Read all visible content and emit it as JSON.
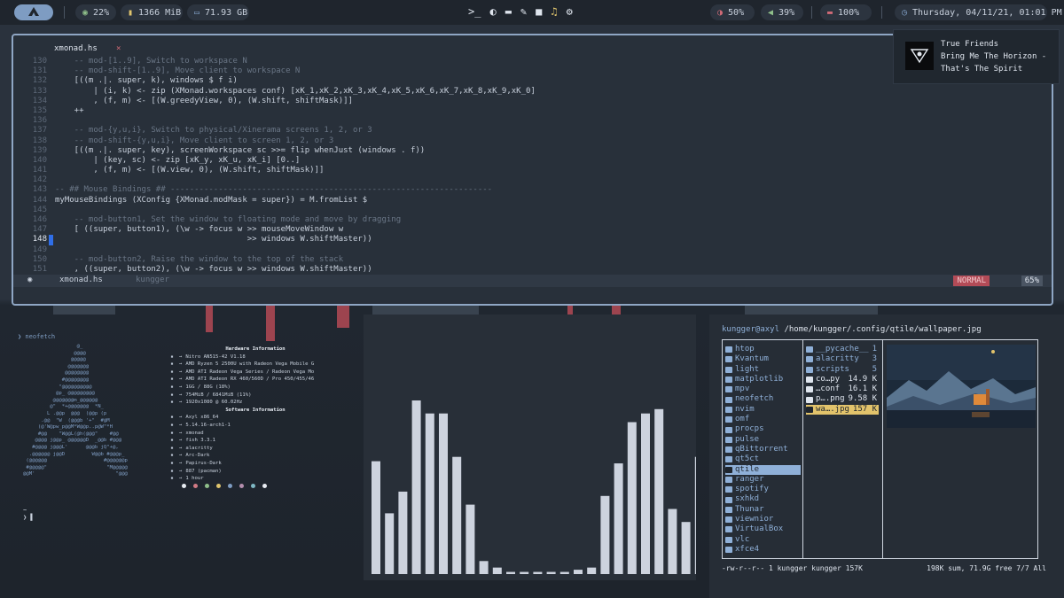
{
  "topbar": {
    "arch_icon": "arch-logo-icon",
    "cpu": "22%",
    "memory": "1366 MiB",
    "disk": "71.93 GB",
    "brightness": "50%",
    "volume": "39%",
    "battery": "100%",
    "datetime": "Thursday, 04/11/21, 01:01 PM",
    "center_icons": [
      "terminal-icon",
      "firefox-icon",
      "folder-icon",
      "edit-icon",
      "video-icon",
      "music-icon",
      "gear-icon"
    ]
  },
  "notification": {
    "title": "True Friends",
    "artist": "Bring Me The Horizon -",
    "album": "That's The Spirit"
  },
  "editor": {
    "tab": "xmonad.hs",
    "tab_close": "×",
    "status_file": "xmonad.hs",
    "status_dir": "kungger",
    "mode": "NORMAL",
    "percent": "65%",
    "lines": [
      {
        "n": "130",
        "t": "    -- mod-[1..9], Switch to workspace N",
        "c": true
      },
      {
        "n": "131",
        "t": "    -- mod-shift-[1..9], Move client to workspace N",
        "c": true
      },
      {
        "n": "132",
        "t": "    [((m .|. super, k), windows $ f i)",
        "c": false
      },
      {
        "n": "133",
        "t": "        | (i, k) <- zip (XMonad.workspaces conf) [xK_1,xK_2,xK_3,xK_4,xK_5,xK_6,xK_7,xK_8,xK_9,xK_0]",
        "c": false
      },
      {
        "n": "134",
        "t": "        , (f, m) <- [(W.greedyView, 0), (W.shift, shiftMask)]]",
        "c": false
      },
      {
        "n": "135",
        "t": "    ++",
        "c": false
      },
      {
        "n": "136",
        "t": "",
        "c": false
      },
      {
        "n": "137",
        "t": "    -- mod-{y,u,i}, Switch to physical/Xinerama screens 1, 2, or 3",
        "c": true
      },
      {
        "n": "138",
        "t": "    -- mod-shift-{y,u,i}, Move client to screen 1, 2, or 3",
        "c": true
      },
      {
        "n": "139",
        "t": "    [((m .|. super, key), screenWorkspace sc >>= flip whenJust (windows . f))",
        "c": false
      },
      {
        "n": "140",
        "t": "        | (key, sc) <- zip [xK_y, xK_u, xK_i] [0..]",
        "c": false
      },
      {
        "n": "141",
        "t": "        , (f, m) <- [(W.view, 0), (W.shift, shiftMask)]]",
        "c": false
      },
      {
        "n": "142",
        "t": "",
        "c": false
      },
      {
        "n": "143",
        "t": "-- ## Mouse Bindings ## -------------------------------------------------------------------",
        "c": true
      },
      {
        "n": "144",
        "t": "myMouseBindings (XConfig {XMonad.modMask = super}) = M.fromList $",
        "c": false
      },
      {
        "n": "145",
        "t": "",
        "c": false
      },
      {
        "n": "146",
        "t": "    -- mod-button1, Set the window to floating mode and move by dragging",
        "c": true
      },
      {
        "n": "147",
        "t": "    [ ((super, button1), (\\w -> focus w >> mouseMoveWindow w",
        "c": false
      },
      {
        "n": "148",
        "t": "                                        >> windows W.shiftMaster))",
        "c": false,
        "cur": true
      },
      {
        "n": "149",
        "t": "",
        "c": false
      },
      {
        "n": "150",
        "t": "    -- mod-button2, Raise the window to the top of the stack",
        "c": true
      },
      {
        "n": "151",
        "t": "    , ((super, button2), (\\w -> focus w >> windows W.shiftMaster))",
        "c": false
      }
    ]
  },
  "neofetch": {
    "prompt": "❯ neofetch",
    "hw_header": "Hardware Information",
    "sw_header": "Software Information",
    "hardware": [
      {
        "icon": "laptop-icon",
        "value": "Nitro AN515-42 V1.18"
      },
      {
        "icon": "cpu-icon",
        "value": "AMD Ryzen 5 2500U with Radeon Vega Mobile G"
      },
      {
        "icon": "gpu-icon",
        "value": "AMD ATI Radeon Vega Series / Radeon Vega Mo"
      },
      {
        "icon": "gpu-icon",
        "value": "AMD ATI Radeon RX 460/560D / Pro 450/455/46"
      },
      {
        "icon": "code-icon",
        "value": "1GG / 88G (18%)"
      },
      {
        "icon": "memory-icon",
        "value": "754MiB / 6841MiB (11%)"
      },
      {
        "icon": "monitor-icon",
        "value": "1920x1080 @ 60.02Hz"
      }
    ],
    "software": [
      {
        "icon": "os-icon",
        "value": "Axyl x86_64"
      },
      {
        "icon": "kernel-icon",
        "value": "5.14.16-arch1-1"
      },
      {
        "icon": "wm-icon",
        "value": "xmonad"
      },
      {
        "icon": "shell-icon",
        "value": "fish 3.3.1"
      },
      {
        "icon": "terminal-icon",
        "value": "alacritty"
      },
      {
        "icon": "theme-icon",
        "value": "Arc-Dark"
      },
      {
        "icon": "icons-icon",
        "value": "Papirus-Dark"
      },
      {
        "icon": "package-icon",
        "value": "887 (pacman)"
      },
      {
        "icon": "uptime-icon",
        "value": "1 hour"
      }
    ],
    "palette": [
      "#e8ecf2",
      "#d07a84",
      "#8fbf8a",
      "#e0c56e",
      "#7e9cc2",
      "#b48ead",
      "#7fb8c4",
      "#e8ecf2"
    ],
    "prompt2": "~\n❯ ▌"
  },
  "visualizer": {
    "bar_heights": [
      0.52,
      0.28,
      0.38,
      0.8,
      0.74,
      0.74,
      0.54,
      0.32,
      0.06,
      0.03,
      0.01,
      0.01,
      0.01,
      0.01,
      0.01,
      0.02,
      0.03,
      0.36,
      0.51,
      0.7,
      0.74,
      0.76,
      0.3,
      0.24,
      0.54
    ]
  },
  "ranger": {
    "header_user": "kungger@axyl",
    "header_path": "/home/kungger/.config/qtile/wallpaper.jpg",
    "dirs": [
      "htop",
      "Kvantum",
      "light",
      "matplotlib",
      "mpv",
      "neofetch",
      "nvim",
      "omf",
      "procps",
      "pulse",
      "qBittorrent",
      "qt5ct",
      "qtile",
      "ranger",
      "spotify",
      "sxhkd",
      "Thunar",
      "viewnior",
      "VirtualBox",
      "vlc",
      "xfce4"
    ],
    "selected_dir": "qtile",
    "files": [
      {
        "name": "__pycache__",
        "size": "1",
        "kind": "dir"
      },
      {
        "name": "alacritty",
        "size": "3",
        "kind": "dir"
      },
      {
        "name": "scripts",
        "size": "5",
        "kind": "dir"
      },
      {
        "name": "co…py",
        "size": "14.9 K",
        "kind": "file"
      },
      {
        "name": "…conf",
        "size": "16.1 K",
        "kind": "file"
      },
      {
        "name": "p….png",
        "size": "9.58 K",
        "kind": "file"
      },
      {
        "name": "wa….jpg",
        "size": "157 K",
        "kind": "hl"
      }
    ],
    "status_left": "-rw-r--r-- 1 kungger kungger 157K",
    "status_right": "198K sum, 71.9G free  7/7  All"
  }
}
